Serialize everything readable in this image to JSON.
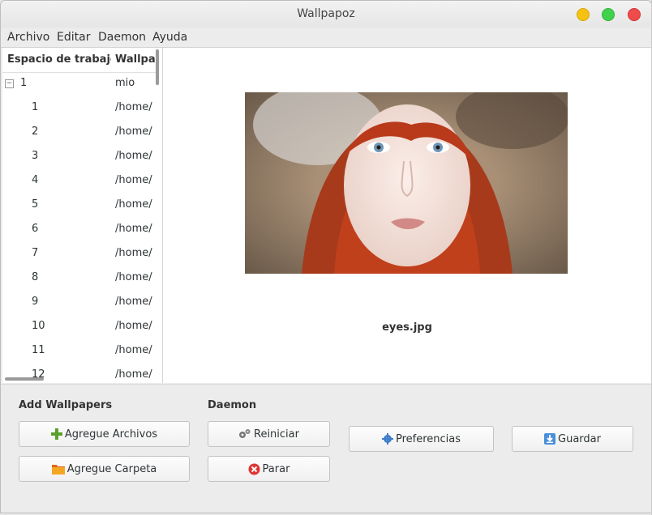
{
  "window": {
    "title": "Wallpapoz"
  },
  "menu": [
    "Archivo",
    "Editar",
    "Daemon",
    "Ayuda"
  ],
  "table": {
    "columns": [
      "Espacio de trabajo",
      "Wallpap"
    ],
    "parent": {
      "workspace": "1",
      "wallpaper": "mio",
      "expander": "−"
    },
    "rows": [
      {
        "workspace": "1",
        "wallpaper": "/home/"
      },
      {
        "workspace": "2",
        "wallpaper": "/home/"
      },
      {
        "workspace": "3",
        "wallpaper": "/home/"
      },
      {
        "workspace": "4",
        "wallpaper": "/home/"
      },
      {
        "workspace": "5",
        "wallpaper": "/home/"
      },
      {
        "workspace": "6",
        "wallpaper": "/home/"
      },
      {
        "workspace": "7",
        "wallpaper": "/home/"
      },
      {
        "workspace": "8",
        "wallpaper": "/home/"
      },
      {
        "workspace": "9",
        "wallpaper": "/home/"
      },
      {
        "workspace": "10",
        "wallpaper": "/home/"
      },
      {
        "workspace": "11",
        "wallpaper": "/home/"
      },
      {
        "workspace": "12",
        "wallpaper": "/home/"
      }
    ]
  },
  "preview": {
    "filename": "eyes.jpg"
  },
  "sections": {
    "add": "Add Wallpapers",
    "daemon": "Daemon"
  },
  "buttons": {
    "add_files": "Agregue Archivos",
    "add_folder": "Agregue Carpeta",
    "restart": "Reiniciar",
    "stop": "Parar",
    "preferences": "Preferencias",
    "save": "Guardar"
  },
  "colors": {
    "close": "#f04b4b",
    "minimize": "#f5c211",
    "maximize": "#3fd24a",
    "hair": "#c0401c"
  }
}
